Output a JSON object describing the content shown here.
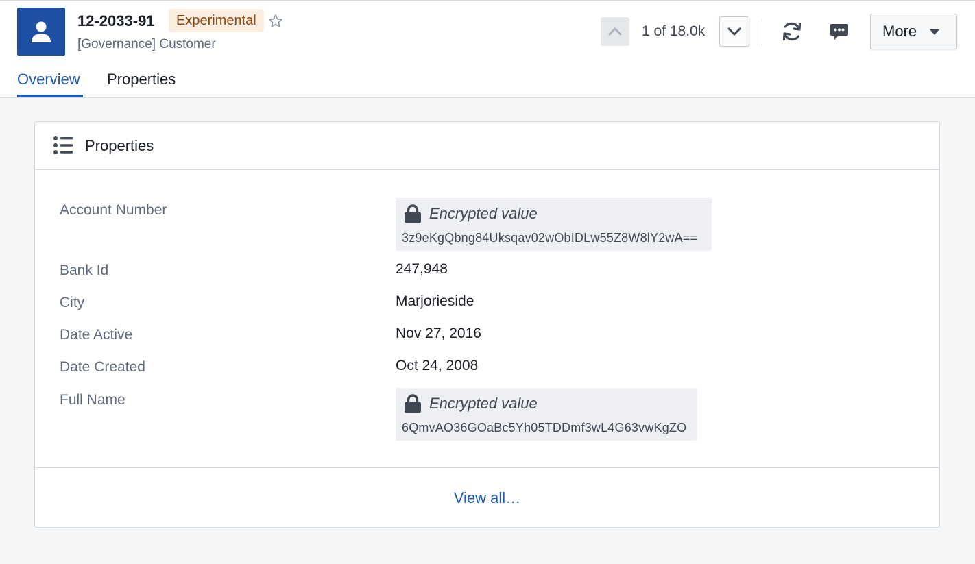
{
  "header": {
    "title": "12-2033-91",
    "badge": "Experimental",
    "subtitle": "[Governance] Customer",
    "counter": "1 of 18.0k",
    "more_label": "More",
    "icons": {
      "avatar": "person-icon",
      "star": "star-icon",
      "up": "chevron-up-icon",
      "down": "chevron-down-icon",
      "refresh": "refresh-icon",
      "comment": "comment-icon",
      "more_caret": "caret-down-icon"
    }
  },
  "tabs": [
    {
      "label": "Overview",
      "active": true
    },
    {
      "label": "Properties",
      "active": false
    }
  ],
  "card": {
    "title": "Properties",
    "icon": "properties-list-icon",
    "properties": [
      {
        "label": "Account Number",
        "encrypted": true,
        "encrypted_label": "Encrypted value",
        "value": "3z9eKgQbng84Uksqav02wObIDLw55Z8W8lY2wA=="
      },
      {
        "label": "Bank Id",
        "encrypted": false,
        "value": "247,948"
      },
      {
        "label": "City",
        "encrypted": false,
        "value": "Marjorieside"
      },
      {
        "label": "Date Active",
        "encrypted": false,
        "value": "Nov 27, 2016"
      },
      {
        "label": "Date Created",
        "encrypted": false,
        "value": "Oct 24, 2008"
      },
      {
        "label": "Full Name",
        "encrypted": true,
        "encrypted_label": "Encrypted value",
        "value": "6QmvAO36GOaBc5Yh05TDDmf3wL4G63vwKgZO"
      }
    ],
    "view_all": "View all…"
  },
  "colors": {
    "accent": "#215db0",
    "avatar_bg": "#1f4fa3",
    "badge_bg": "#fbece0",
    "badge_text": "#8a4b10",
    "page_bg": "#f5f6f8"
  }
}
